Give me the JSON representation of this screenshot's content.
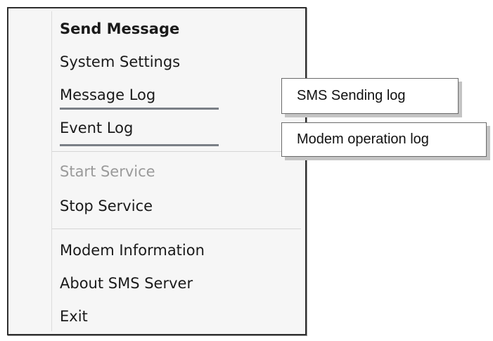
{
  "menu": {
    "items": [
      {
        "label": "Send Message",
        "bold": true,
        "disabled": false
      },
      {
        "label": "System Settings",
        "bold": false,
        "disabled": false
      },
      {
        "label": "Message Log",
        "bold": false,
        "disabled": false
      },
      {
        "label": "Event Log",
        "bold": false,
        "disabled": false
      },
      {
        "label": "Start Service",
        "bold": false,
        "disabled": true
      },
      {
        "label": "Stop Service",
        "bold": false,
        "disabled": false
      },
      {
        "label": "Modem Information",
        "bold": false,
        "disabled": false
      },
      {
        "label": "About SMS Server",
        "bold": false,
        "disabled": false
      },
      {
        "label": "Exit",
        "bold": false,
        "disabled": false
      }
    ]
  },
  "callouts": {
    "message_log": "SMS Sending log",
    "event_log": "Modem operation log"
  }
}
